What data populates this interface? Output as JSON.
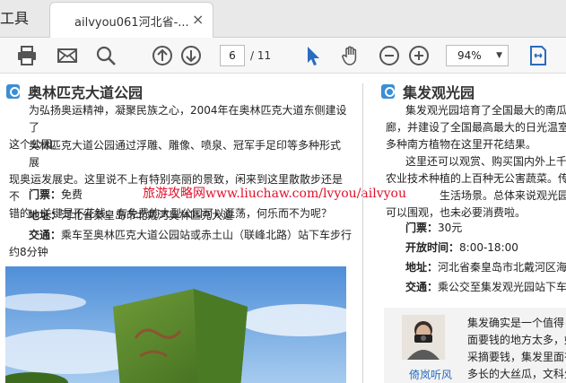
{
  "tabbar": {
    "tools_tab": "工具",
    "doc_tab_title": "ailvyou061河北省-...",
    "close_glyph": "×"
  },
  "toolbar": {
    "current_page": "6",
    "total_pages": "/ 11",
    "zoom": "94%"
  },
  "watermark": "旅游攻略网www.liuchaw.com/lvyou/ailvyou",
  "left": {
    "title": "奥林匹克大道公园",
    "para1": [
      "为弘扬奥运精神，凝聚民族之心，2004年在奥林匹克大道东侧建设了",
      "这个公园。"
    ],
    "para2": [
      "奥林匹克大道公园通过浮雕、雕像、喷泉、冠军手足印等多种形式展",
      "现奥运发展史。这里说不上有特别亮丽的景致，闲来到这里散散步还是不",
      "错的，关键是不花钱。有免费的大型公园可以逛荡，何乐而不为呢？"
    ],
    "ticket_label": "门票：",
    "ticket_value": "免费",
    "address_label": "地址：",
    "address_value": "河北省秦皇岛市北戴河奥林匹克大道",
    "traffic_label": "交通：",
    "traffic_lines": [
      "乘车至奥林匹克大道公园站或赤土山（联峰北路）站下车步行",
      "约8分钟"
    ]
  },
  "right": {
    "title": "集发观光园",
    "para1": [
      "集发观光园培育了全国最大的南瓜王",
      "廊，并建设了全国最高最大的日光温室，",
      "多种南方植物在这里开花结果。"
    ],
    "para2": [
      "这里还可以观赏、购买国内外上千种",
      "农业技术种植的上百种无公害蔬菜。传统",
      "生活场景。总体来说观光园还是值",
      "可以围观，也未必要消费啦。"
    ],
    "ticket_label": "门票：",
    "ticket_value": "30元",
    "hours_label": "开放时间：",
    "hours_value": "8:00-18:00",
    "address_label": "地址：",
    "address_value": "河北省秦皇岛市北戴河区海北",
    "traffic_label": "交通：",
    "traffic_value": "乘公交至集发观光园站下车即",
    "author_name": "倚岚听风",
    "quote_lines": [
      "集发确实是一个值得",
      "面要钱的地方太多，好",
      "采摘要钱，集发里面有",
      "多长的大丝瓜，文科生"
    ]
  }
}
